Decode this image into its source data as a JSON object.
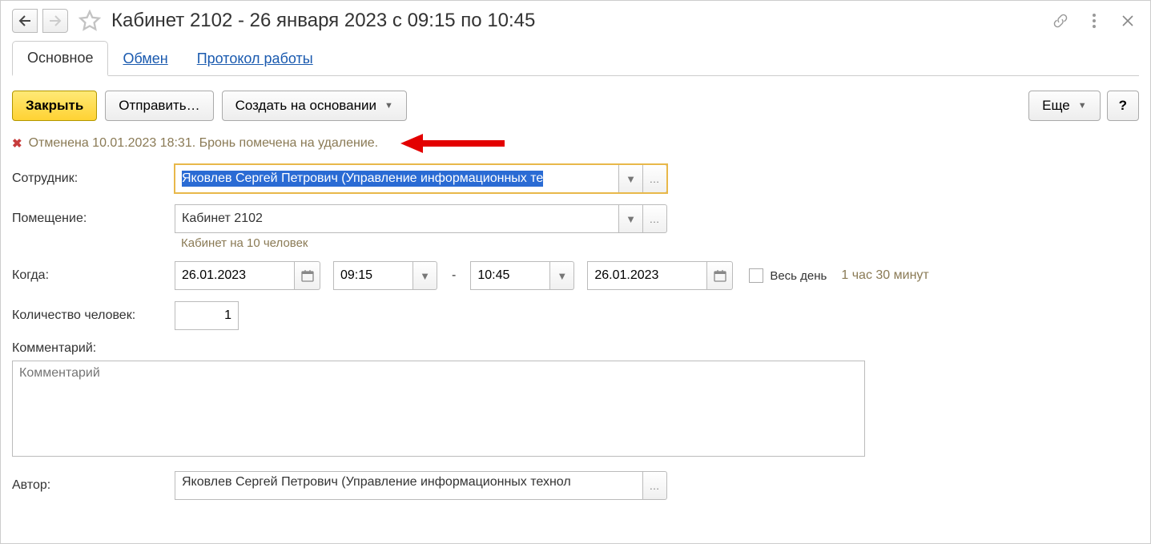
{
  "header": {
    "title": "Кабинет 2102 - 26 января 2023 с 09:15 по 10:45"
  },
  "tabs": {
    "main": "Основное",
    "exchange": "Обмен",
    "protocol": "Протокол работы"
  },
  "toolbar": {
    "close": "Закрыть",
    "send": "Отправить…",
    "create_based": "Создать на основании",
    "more": "Еще",
    "help": "?"
  },
  "status": {
    "text": "Отменена 10.01.2023 18:31. Бронь помечена на удаление."
  },
  "form": {
    "employee_label": "Сотрудник:",
    "employee_value": "Яковлев Сергей Петрович (Управление информационных те",
    "room_label": "Помещение:",
    "room_value": "Кабинет 2102",
    "room_hint": "Кабинет на 10 человек",
    "when_label": "Когда:",
    "date_from": "26.01.2023",
    "time_from": "09:15",
    "time_to": "10:45",
    "date_to": "26.01.2023",
    "all_day_label": "Весь день",
    "duration": "1 час 30 минут",
    "people_label": "Количество человек:",
    "people_value": "1",
    "comment_label": "Комментарий:",
    "comment_placeholder": "Комментарий",
    "author_label": "Автор:",
    "author_value": "Яковлев Сергей Петрович (Управление информационных технол"
  }
}
